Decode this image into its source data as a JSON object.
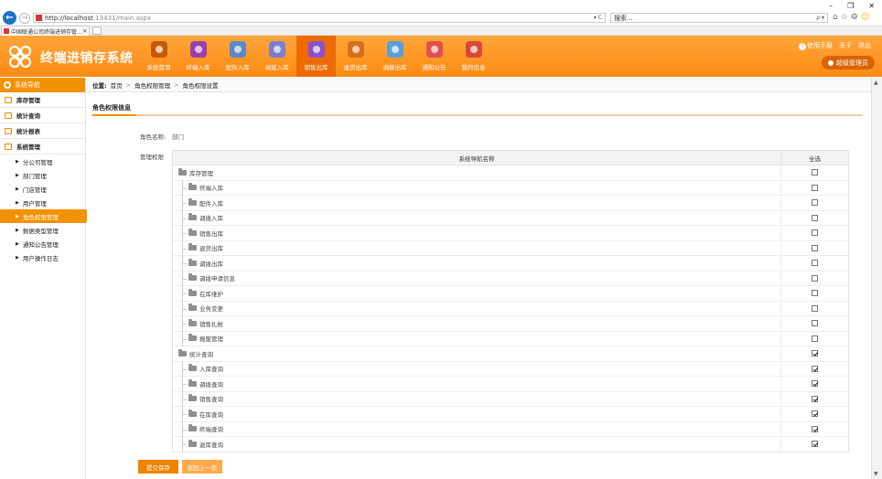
{
  "browser": {
    "url_prefix": "http://localhost",
    "url_suffix": ":13431/main.aspx",
    "search_placeholder": "搜索...",
    "tab_title": "中国联通公司终端进销存管...",
    "url_controls": "▾ C",
    "search_controls": "ρ ▾"
  },
  "header": {
    "system_title": "终端进销存系统",
    "help_link": "使用手册",
    "about_link": "关于",
    "logout_link": "退出",
    "user_button": "超级管理员",
    "modules": [
      {
        "label": "系统首页",
        "color": "#c65a00"
      },
      {
        "label": "终端入库",
        "color": "#9b3fb0"
      },
      {
        "label": "配件入库",
        "color": "#5a88c8"
      },
      {
        "label": "调拨入库",
        "color": "#7a7fd0"
      },
      {
        "label": "销售出库",
        "color": "#8a4fd0",
        "active": true
      },
      {
        "label": "退货出库",
        "color": "#d87018"
      },
      {
        "label": "调拨出库",
        "color": "#5aa0d8"
      },
      {
        "label": "通知公告",
        "color": "#e05050"
      },
      {
        "label": "我的信息",
        "color": "#d84838"
      }
    ]
  },
  "sidebar": {
    "title": "系统导航",
    "groups": [
      {
        "label": "库存管理"
      },
      {
        "label": "统计查询"
      },
      {
        "label": "统计报表"
      },
      {
        "label": "系统管理"
      }
    ],
    "items": [
      {
        "label": "分公司管理"
      },
      {
        "label": "部门管理"
      },
      {
        "label": "门店管理"
      },
      {
        "label": "用户管理"
      },
      {
        "label": "角色权限管理",
        "active": true
      },
      {
        "label": "数据类型管理"
      },
      {
        "label": "通知公告管理"
      },
      {
        "label": "用户操作日志"
      }
    ]
  },
  "breadcrumb": {
    "prefix": "位置:",
    "items": [
      "首页",
      "角色权限管理",
      "角色权限设置"
    ]
  },
  "content": {
    "section_title": "角色权限信息",
    "role_label": "角色名称:",
    "role_value": "部门",
    "perm_label": "管理权限",
    "col_name": "系统导航名称",
    "col_all": "全选",
    "rows": [
      {
        "label": "库存管理",
        "level": 0,
        "checked": false
      },
      {
        "label": "终端入库",
        "level": 1,
        "checked": false
      },
      {
        "label": "配件入库",
        "level": 1,
        "checked": false
      },
      {
        "label": "调拨入库",
        "level": 1,
        "checked": false
      },
      {
        "label": "销售出库",
        "level": 1,
        "checked": false
      },
      {
        "label": "退货出库",
        "level": 1,
        "checked": false
      },
      {
        "label": "调拨出库",
        "level": 1,
        "checked": false
      },
      {
        "label": "调拨申请信息",
        "level": 1,
        "checked": false
      },
      {
        "label": "在库维护",
        "level": 1,
        "checked": false
      },
      {
        "label": "业务变更",
        "level": 1,
        "checked": false
      },
      {
        "label": "销售扎帐",
        "level": 1,
        "checked": false
      },
      {
        "label": "报废管理",
        "level": 1,
        "checked": false
      },
      {
        "label": "统计查询",
        "level": 0,
        "checked": true
      },
      {
        "label": "入库查询",
        "level": 1,
        "checked": true
      },
      {
        "label": "调拨查询",
        "level": 1,
        "checked": true
      },
      {
        "label": "销售查询",
        "level": 1,
        "checked": true
      },
      {
        "label": "在库查询",
        "level": 1,
        "checked": true
      },
      {
        "label": "终端查询",
        "level": 1,
        "checked": true
      },
      {
        "label": "退库查询",
        "level": 1,
        "checked": true
      }
    ],
    "save_button": "提交保存",
    "back_button": "返回上一页"
  }
}
